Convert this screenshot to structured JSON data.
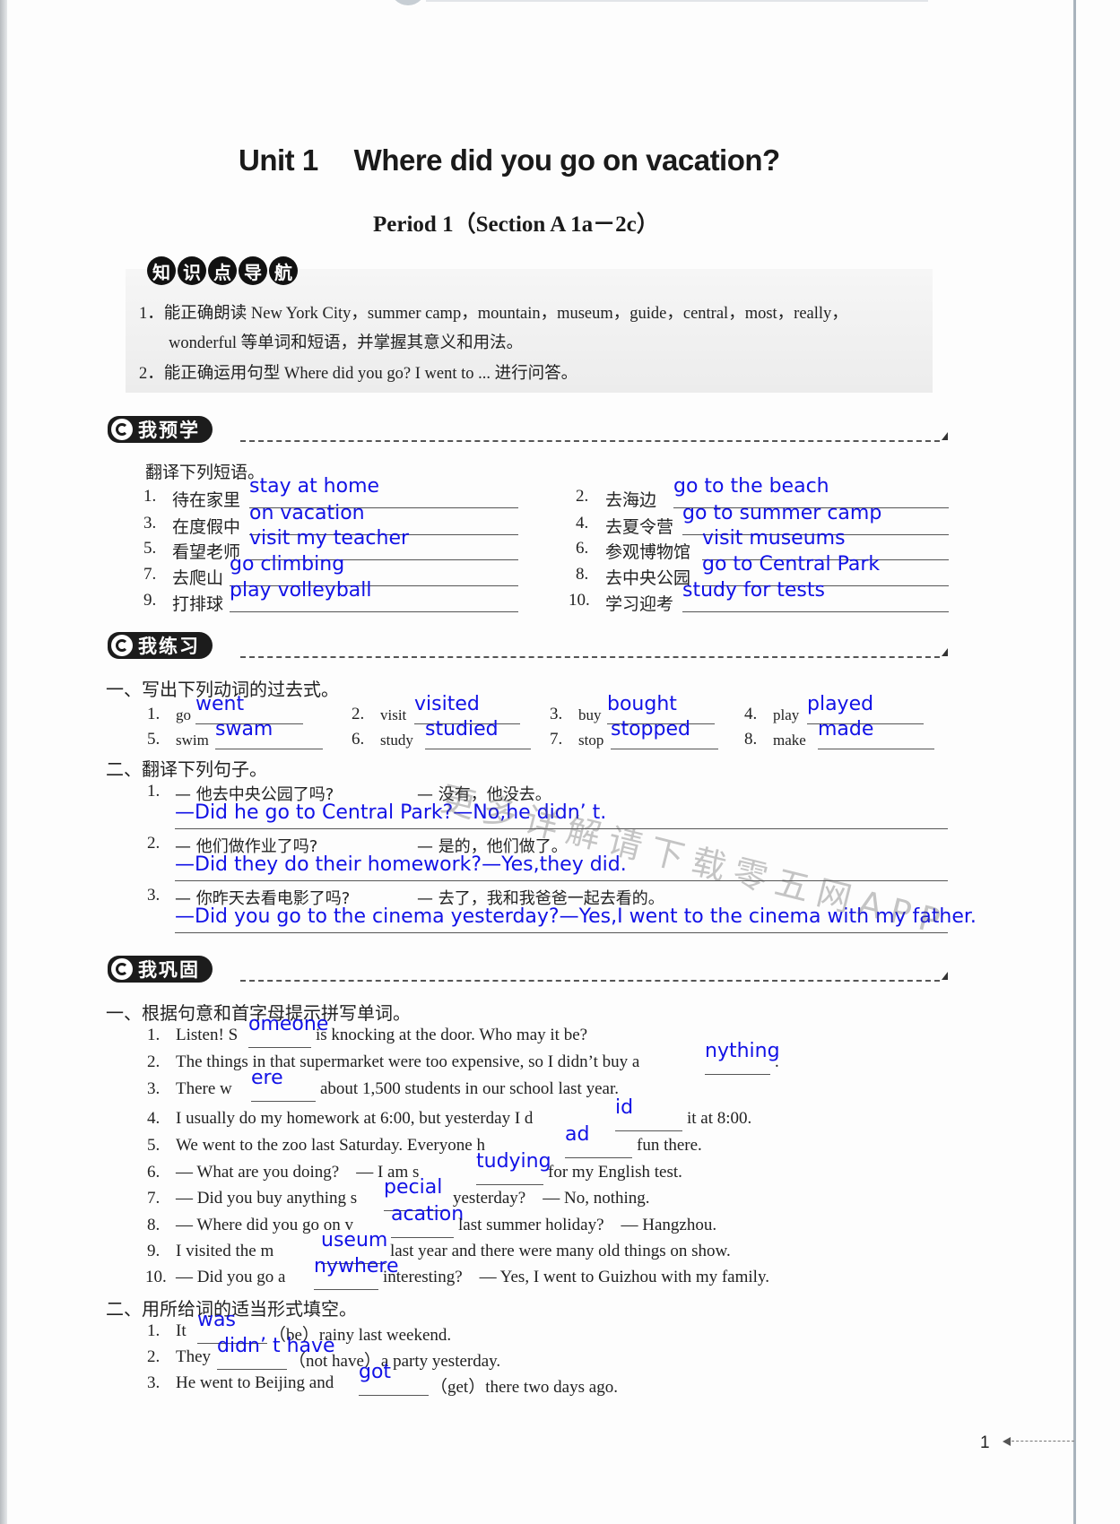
{
  "unit": {
    "label": "Unit 1",
    "title": "Where did you go on vacation?"
  },
  "period": "Period 1（Section A 1a－2c）",
  "knowledge": {
    "badge_chars": [
      "知",
      "识",
      "点",
      "导",
      "航"
    ],
    "items": [
      "1．能正确朗读 New York City，summer camp，mountain，museum，guide，central，most，really，",
      "wonderful 等单词和短语，并掌握其意义和用法。",
      "2．能正确运用句型 Where did you go? I went to ... 进行问答。"
    ]
  },
  "preview": {
    "title": "我预学",
    "instruction": "翻译下列短语。",
    "items": [
      {
        "num": "1.",
        "prompt": "待在家里",
        "answer": "stay at home"
      },
      {
        "num": "2.",
        "prompt": "去海边",
        "answer": "go to the beach"
      },
      {
        "num": "3.",
        "prompt": "在度假中",
        "answer": "on vacation"
      },
      {
        "num": "4.",
        "prompt": "去夏令营",
        "answer": "go to summer camp"
      },
      {
        "num": "5.",
        "prompt": "看望老师",
        "answer": "visit my teacher"
      },
      {
        "num": "6.",
        "prompt": "参观博物馆",
        "answer": "visit museums"
      },
      {
        "num": "7.",
        "prompt": "去爬山",
        "answer": "go climbing"
      },
      {
        "num": "8.",
        "prompt": "去中央公园",
        "answer": "go to Central Park"
      },
      {
        "num": "9.",
        "prompt": "打排球",
        "answer": "play volleyball"
      },
      {
        "num": "10.",
        "prompt": "学习迎考",
        "answer": "study for tests"
      }
    ]
  },
  "practice": {
    "title": "我练习",
    "part1": {
      "heading": "一、写出下列动词的过去式。",
      "items": [
        {
          "num": "1.",
          "verb": "go",
          "answer": "went"
        },
        {
          "num": "2.",
          "verb": "visit",
          "answer": "visited"
        },
        {
          "num": "3.",
          "verb": "buy",
          "answer": "bought"
        },
        {
          "num": "4.",
          "verb": "play",
          "answer": "played"
        },
        {
          "num": "5.",
          "verb": "swim",
          "answer": "swam"
        },
        {
          "num": "6.",
          "verb": "study",
          "answer": "studied"
        },
        {
          "num": "7.",
          "verb": "stop",
          "answer": "stopped"
        },
        {
          "num": "8.",
          "verb": "make",
          "answer": "made"
        }
      ]
    },
    "part2": {
      "heading": "二、翻译下列句子。",
      "items": [
        {
          "num": "1.",
          "q": "— 他去中央公园了吗?",
          "a": "— 没有，他没去。",
          "answer": "—Did he go to Central Park?—No,he didn’ t."
        },
        {
          "num": "2.",
          "q": "— 他们做作业了吗?",
          "a": "— 是的，他们做了。",
          "answer": "—Did they do their homework?—Yes,they did."
        },
        {
          "num": "3.",
          "q": "— 你昨天去看电影了吗?",
          "a": "— 去了，我和我爸爸一起去看的。",
          "answer": "—Did you go to the cinema yesterday?—Yes,I went to the cinema with my father."
        }
      ]
    }
  },
  "consolidate": {
    "title": "我巩固",
    "part1": {
      "heading": "一、根据句意和首字母提示拼写单词。",
      "items": [
        {
          "num": "1.",
          "before": "Listen! S",
          "answer": "omeone",
          "after": "is knocking at the door. Who may it be?"
        },
        {
          "num": "2.",
          "before": "The things in that supermarket were too expensive, so I didn’t buy a",
          "answer": "nything",
          "after": "."
        },
        {
          "num": "3.",
          "before": "There w",
          "answer": "ere",
          "after": "about 1,500 students in our school last year."
        },
        {
          "num": "4.",
          "before": "I usually do my homework at 6:00, but yesterday I d",
          "answer": "id",
          "after": "it at 8:00."
        },
        {
          "num": "5.",
          "before": "We went to the zoo last Saturday. Everyone h",
          "answer": "ad",
          "after": "fun there."
        },
        {
          "num": "6.",
          "before": "— What are you doing?    — I am s",
          "answer": "tudying",
          "after": "for my English test."
        },
        {
          "num": "7.",
          "before": "— Did you buy anything s",
          "answer": "pecial",
          "after": "yesterday?    — No, nothing."
        },
        {
          "num": "8.",
          "before": "— Where did you go on v",
          "answer": "acation",
          "after": "last summer holiday?    — Hangzhou."
        },
        {
          "num": "9.",
          "before": "I visited the m",
          "answer": "useum",
          "after": "last year and there were many old things on show."
        },
        {
          "num": "10.",
          "before": "— Did you go a",
          "answer": "nywhere",
          "after": "interesting?    — Yes, I went to Guizhou with my family."
        }
      ]
    },
    "part2": {
      "heading": "二、用所给词的适当形式填空。",
      "items": [
        {
          "num": "1.",
          "before": "It",
          "answer": "was",
          "after": "（be）rainy last weekend."
        },
        {
          "num": "2.",
          "before": "They",
          "answer": "didn’ t have",
          "after": "（not have）a party yesterday."
        },
        {
          "num": "3.",
          "before": "He went to Beijing and",
          "answer": "got",
          "after": "（get）there two days ago."
        }
      ]
    }
  },
  "watermark": "更多详解请下载零五网APP",
  "page_number": "1"
}
